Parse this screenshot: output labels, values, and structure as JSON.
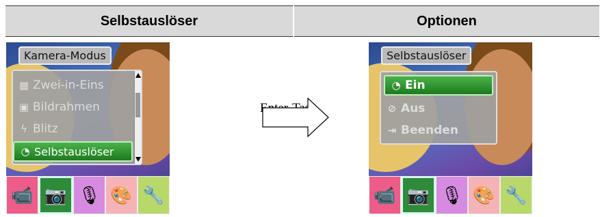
{
  "left_panel": {
    "title": "Selbstauslöser",
    "mode_label": "Kamera-Modus",
    "items": [
      {
        "label": "Zwei-in-Eins",
        "icon": "two-in-one-icon",
        "selected": false
      },
      {
        "label": "Bildrahmen",
        "icon": "frame-icon",
        "selected": false
      },
      {
        "label": "Blitz",
        "icon": "flash-icon",
        "selected": false
      },
      {
        "label": "Selbstauslöser",
        "icon": "self-timer-icon",
        "selected": true
      }
    ]
  },
  "right_panel": {
    "title": "Optionen",
    "menu_label": "Selbstauslöser",
    "items": [
      {
        "label": "Ein",
        "icon": "timer-on-icon",
        "selected": true
      },
      {
        "label": "Aus",
        "icon": "timer-off-icon",
        "selected": false
      },
      {
        "label": "Beenden",
        "icon": "exit-icon",
        "selected": false
      }
    ]
  },
  "arrow_label": "Enter-Tast",
  "tabs": [
    {
      "icon": "video-camera-icon",
      "color": "#ee5c8a"
    },
    {
      "icon": "camera-icon",
      "color": "#2f8a3a"
    },
    {
      "icon": "microphone-icon",
      "color": "#d68be0"
    },
    {
      "icon": "palette-icon",
      "color": "#f6b3b7"
    },
    {
      "icon": "tools-icon",
      "color": "#b8d86a"
    }
  ]
}
